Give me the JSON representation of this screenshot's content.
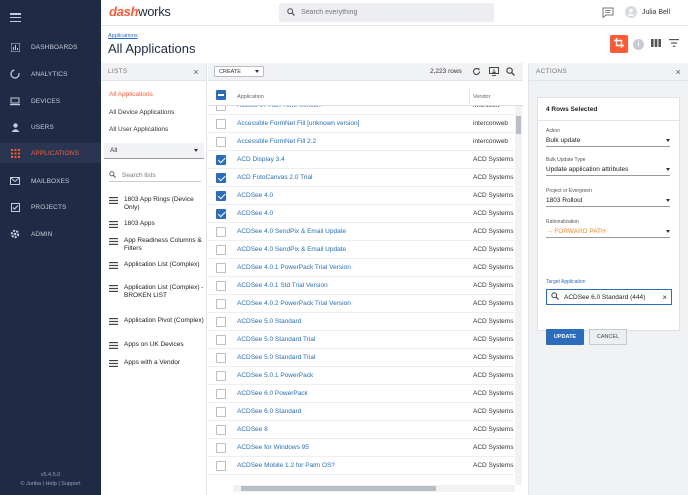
{
  "brand": {
    "dash": "dash",
    "works": "works"
  },
  "colors": {
    "accent": "#ff5a36",
    "nav_bg": "#1f2a44",
    "link": "#2a6ebb",
    "path": "#f28c28"
  },
  "nav": {
    "items": [
      {
        "label": "DASHBOARDS",
        "icon": "dashboard-icon"
      },
      {
        "label": "ANALYTICS",
        "icon": "analytics-icon"
      },
      {
        "label": "DEVICES",
        "icon": "laptop-icon"
      },
      {
        "label": "USERS",
        "icon": "user-icon"
      },
      {
        "label": "APPLICATIONS",
        "icon": "grid-icon"
      },
      {
        "label": "MAILBOXES",
        "icon": "mail-icon"
      },
      {
        "label": "PROJECTS",
        "icon": "checklist-icon"
      },
      {
        "label": "ADMIN",
        "icon": "gear-icon"
      }
    ],
    "version": "v5.4.5.0",
    "footer": "© Juriba | Help | Support"
  },
  "search": {
    "placeholder": "Search everything"
  },
  "user": {
    "name": "Julia Bell"
  },
  "page": {
    "breadcrumb": "Applications",
    "title": "All Applications"
  },
  "lists": {
    "header": "LISTS",
    "links": [
      "All Applications",
      "All Device Applications",
      "All User Applications"
    ],
    "filter": "All",
    "search_placeholder": "Search lists",
    "entries": [
      "1803 App Rings (Device Only)",
      "1803 Apps",
      "App Readiness Columns & Filters",
      "Application List (Complex)",
      "Application List (Complex) - BROKEN LIST",
      "Application Pivot (Complex)",
      "Apps on UK Devices",
      "Apps with a Vendor"
    ]
  },
  "grid": {
    "create_label": "CREATE",
    "row_count": "2,223 rows",
    "columns": {
      "app": "Application",
      "vendor": "Vendor"
    },
    "rows": [
      {
        "app": "Access 97 Run-Time Version",
        "vendor": "Microsoft",
        "checked": false
      },
      {
        "app": "Accessible FormNet Fill [unknown version]",
        "vendor": "interconweb",
        "checked": false
      },
      {
        "app": "Accessible FormNet Fill 2.2",
        "vendor": "interconweb",
        "checked": false
      },
      {
        "app": "ACD Display 3.4",
        "vendor": "ACD Systems",
        "checked": true
      },
      {
        "app": "ACD FotoCanvas 2.0 Trial",
        "vendor": "ACD Systems",
        "checked": true
      },
      {
        "app": "ACDSee 4.0",
        "vendor": "ACD Systems",
        "checked": true
      },
      {
        "app": "ACDSee 4.0",
        "vendor": "ACD Systems",
        "checked": true
      },
      {
        "app": "ACDSee 4.0 SendPix & Email Update",
        "vendor": "ACD Systems",
        "checked": false
      },
      {
        "app": "ACDSee 4.0 SendPix & Email Update",
        "vendor": "ACD Systems",
        "checked": false
      },
      {
        "app": "ACDSee 4.0.1 PowerPack Trial Version",
        "vendor": "ACD Systems",
        "checked": false
      },
      {
        "app": "ACDSee 4.0.1 Std Trial Version",
        "vendor": "ACD Systems",
        "checked": false
      },
      {
        "app": "ACDSee 4.0.2 PowerPack Trial Version",
        "vendor": "ACD Systems",
        "checked": false
      },
      {
        "app": "ACDSee 5.0 Standard",
        "vendor": "ACD Systems",
        "checked": false
      },
      {
        "app": "ACDSee 5.0 Standard Trial",
        "vendor": "ACD Systems",
        "checked": false
      },
      {
        "app": "ACDSee 5.0 Standard Trial",
        "vendor": "ACD Systems",
        "checked": false
      },
      {
        "app": "ACDSee 5.0.1 PowerPack",
        "vendor": "ACD Systems",
        "checked": false
      },
      {
        "app": "ACDSee 6.0 PowerPack",
        "vendor": "ACD Systems",
        "checked": false
      },
      {
        "app": "ACDSee 6.0 Standard",
        "vendor": "ACD Systems",
        "checked": false
      },
      {
        "app": "ACDSee 8",
        "vendor": "ACD Systems",
        "checked": false
      },
      {
        "app": "ACDSee for Windows 95",
        "vendor": "ACD Systems",
        "checked": false
      },
      {
        "app": "ACDSee Mobile 1.2 for Palm OS?",
        "vendor": "ACD Systems",
        "checked": false
      }
    ]
  },
  "actions": {
    "header": "ACTIONS",
    "selected": "4 Rows Selected",
    "fields": [
      {
        "label": "Action",
        "value": "Bulk update"
      },
      {
        "label": "Bulk Update Type",
        "value": "Update application attributes"
      },
      {
        "label": "Project or Evergreen",
        "value": "1803 Rollout"
      },
      {
        "label": "Rationalization",
        "value": "FORWARD PATH"
      }
    ],
    "target_label": "Target Application",
    "target_value": "ACDSee 6.0 Standard (444)",
    "update_label": "UPDATE",
    "cancel_label": "CANCEL"
  }
}
